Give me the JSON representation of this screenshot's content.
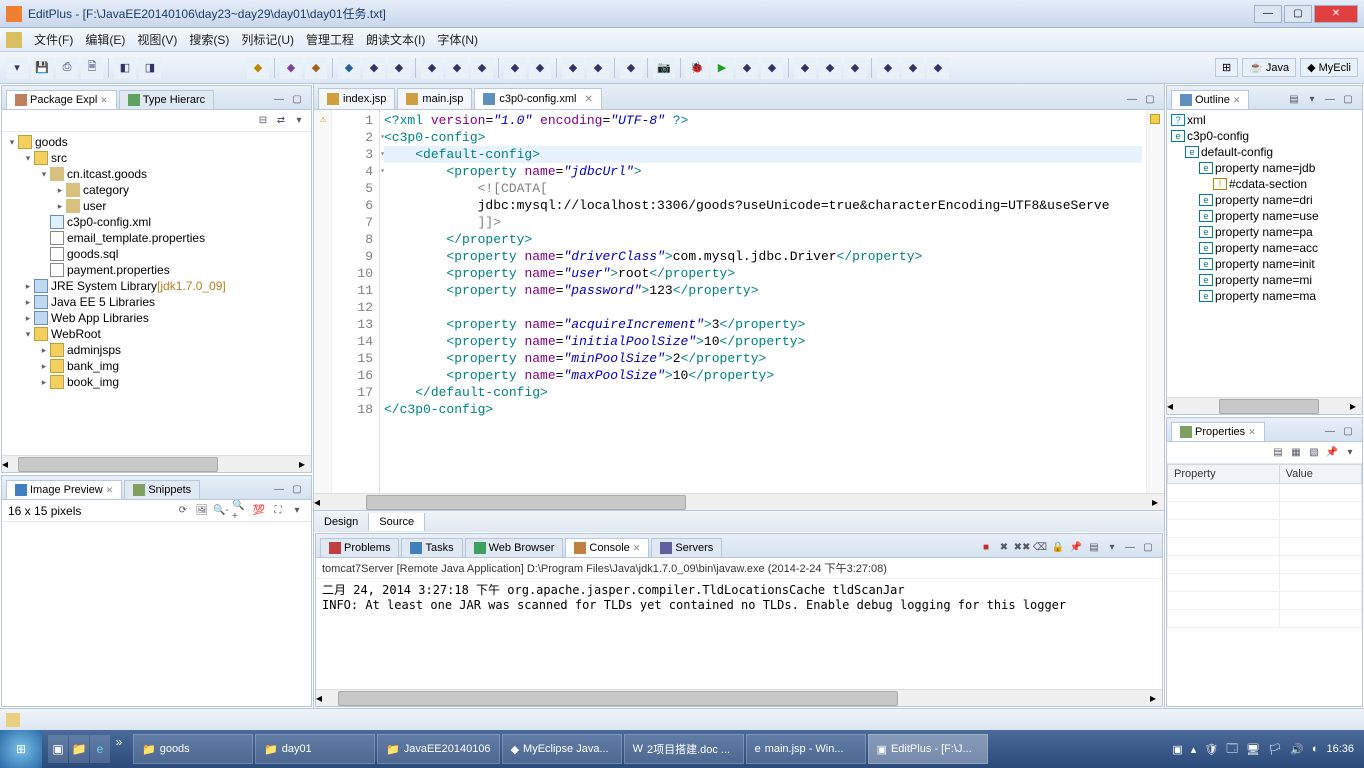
{
  "title": "EditPlus - [F:\\JavaEE20140106\\day23~day29\\day01\\day01任务.txt]",
  "menu": [
    "文件(F)",
    "编辑(E)",
    "视图(V)",
    "搜索(S)",
    "列标记(U)",
    "管理工程",
    "朗读文本(I)",
    "字体(N)"
  ],
  "perspectives": [
    {
      "label": "Java"
    },
    {
      "label": "MyEcli"
    }
  ],
  "package_explorer": {
    "tab": "Package Expl",
    "tab2": "Type Hierarc",
    "tree": [
      {
        "level": 0,
        "icon": "ic-folder",
        "label": "goods",
        "tw": "▾"
      },
      {
        "level": 1,
        "icon": "ic-folder",
        "label": "src",
        "tw": "▾"
      },
      {
        "level": 2,
        "icon": "ic-pkg",
        "label": "cn.itcast.goods",
        "tw": "▾"
      },
      {
        "level": 3,
        "icon": "ic-pkg",
        "label": "category",
        "tw": "▸"
      },
      {
        "level": 3,
        "icon": "ic-pkg",
        "label": "user",
        "tw": "▸"
      },
      {
        "level": 2,
        "icon": "ic-xml",
        "label": "c3p0-config.xml",
        "tw": ""
      },
      {
        "level": 2,
        "icon": "ic-file",
        "label": "email_template.properties",
        "tw": ""
      },
      {
        "level": 2,
        "icon": "ic-file",
        "label": "goods.sql",
        "tw": ""
      },
      {
        "level": 2,
        "icon": "ic-file",
        "label": "payment.properties",
        "tw": ""
      },
      {
        "level": 1,
        "icon": "ic-lib",
        "label": "JRE System Library",
        "suffix": "[jdk1.7.0_09]",
        "tw": "▸"
      },
      {
        "level": 1,
        "icon": "ic-lib",
        "label": "Java EE 5 Libraries",
        "tw": "▸"
      },
      {
        "level": 1,
        "icon": "ic-lib",
        "label": "Web App Libraries",
        "tw": "▸"
      },
      {
        "level": 1,
        "icon": "ic-folder",
        "label": "WebRoot",
        "tw": "▾"
      },
      {
        "level": 2,
        "icon": "ic-folder",
        "label": "adminjsps",
        "tw": "▸"
      },
      {
        "level": 2,
        "icon": "ic-folder",
        "label": "bank_img",
        "tw": "▸"
      },
      {
        "level": 2,
        "icon": "ic-folder",
        "label": "book_img",
        "tw": "▸"
      }
    ]
  },
  "image_preview": {
    "tab": "Image Preview",
    "tab2": "Snippets",
    "status": "16 x 15 pixels"
  },
  "editor_tabs": [
    {
      "label": "index.jsp",
      "active": false
    },
    {
      "label": "main.jsp",
      "active": false
    },
    {
      "label": "c3p0-config.xml",
      "active": true
    }
  ],
  "code": {
    "lines": [
      {
        "n": 1,
        "warn": true,
        "html": "<span class='t-pi'>&lt;?xml</span> <span class='t-attr'>version</span>=<span class='t-str'>\"1.0\"</span> <span class='t-attr'>encoding</span>=<span class='t-str'>\"UTF-8\"</span> <span class='t-pi'>?&gt;</span>"
      },
      {
        "n": 2,
        "fold": true,
        "html": "<span class='t-tag'>&lt;c3p0-config&gt;</span>"
      },
      {
        "n": 3,
        "fold": true,
        "hl": true,
        "html": "    <span class='t-tag'>&lt;default-config&gt;</span>"
      },
      {
        "n": 4,
        "fold": true,
        "html": "        <span class='t-tag'>&lt;property</span> <span class='t-attr'>name</span>=<span class='t-str'>\"jdbcUrl\"</span><span class='t-tag'>&gt;</span>"
      },
      {
        "n": 5,
        "html": "            <span class='t-cd'>&lt;![CDATA[</span>"
      },
      {
        "n": 6,
        "html": "            <span class='t-txt'>jdbc:mysql://localhost:3306/goods?useUnicode=true&amp;characterEncoding=UTF8&amp;useServe</span>"
      },
      {
        "n": 7,
        "html": "            <span class='t-cd'>]]&gt;</span>"
      },
      {
        "n": 8,
        "html": "        <span class='t-tag'>&lt;/property&gt;</span>"
      },
      {
        "n": 9,
        "html": "        <span class='t-tag'>&lt;property</span> <span class='t-attr'>name</span>=<span class='t-str'>\"driverClass\"</span><span class='t-tag'>&gt;</span><span class='t-txt'>com.mysql.jdbc.Driver</span><span class='t-tag'>&lt;/property&gt;</span>"
      },
      {
        "n": 10,
        "html": "        <span class='t-tag'>&lt;property</span> <span class='t-attr'>name</span>=<span class='t-str'>\"user\"</span><span class='t-tag'>&gt;</span><span class='t-txt'>root</span><span class='t-tag'>&lt;/property&gt;</span>"
      },
      {
        "n": 11,
        "html": "        <span class='t-tag'>&lt;property</span> <span class='t-attr'>name</span>=<span class='t-str'>\"password\"</span><span class='t-tag'>&gt;</span><span class='t-txt'>123</span><span class='t-tag'>&lt;/property&gt;</span>"
      },
      {
        "n": 12,
        "html": ""
      },
      {
        "n": 13,
        "html": "        <span class='t-tag'>&lt;property</span> <span class='t-attr'>name</span>=<span class='t-str'>\"acquireIncrement\"</span><span class='t-tag'>&gt;</span><span class='t-txt'>3</span><span class='t-tag'>&lt;/property&gt;</span>"
      },
      {
        "n": 14,
        "html": "        <span class='t-tag'>&lt;property</span> <span class='t-attr'>name</span>=<span class='t-str'>\"initialPoolSize\"</span><span class='t-tag'>&gt;</span><span class='t-txt'>10</span><span class='t-tag'>&lt;/property&gt;</span>"
      },
      {
        "n": 15,
        "html": "        <span class='t-tag'>&lt;property</span> <span class='t-attr'>name</span>=<span class='t-str'>\"minPoolSize\"</span><span class='t-tag'>&gt;</span><span class='t-txt'>2</span><span class='t-tag'>&lt;/property&gt;</span>"
      },
      {
        "n": 16,
        "html": "        <span class='t-tag'>&lt;property</span> <span class='t-attr'>name</span>=<span class='t-str'>\"maxPoolSize\"</span><span class='t-tag'>&gt;</span><span class='t-txt'>10</span><span class='t-tag'>&lt;/property&gt;</span>"
      },
      {
        "n": 17,
        "html": "    <span class='t-tag'>&lt;/default-config&gt;</span>"
      },
      {
        "n": 18,
        "html": "<span class='t-tag'>&lt;/c3p0-config&gt;</span>"
      }
    ]
  },
  "editor_bottom": [
    "Design",
    "Source"
  ],
  "console": {
    "tabs": [
      "Problems",
      "Tasks",
      "Web Browser",
      "Console",
      "Servers"
    ],
    "head": "tomcat7Server [Remote Java Application] D:\\Program Files\\Java\\jdk1.7.0_09\\bin\\javaw.exe (2014-2-24 下午3:27:08)",
    "lines": [
      "二月 24, 2014 3:27:18 下午 org.apache.jasper.compiler.TldLocationsCache tldScanJar",
      "INFO: At least one JAR was scanned for TLDs yet contained no TLDs. Enable debug logging for this logger"
    ]
  },
  "outline": {
    "tab": "Outline",
    "items": [
      {
        "level": 0,
        "icon": "?",
        "label": "xml"
      },
      {
        "level": 0,
        "icon": "e",
        "label": "c3p0-config"
      },
      {
        "level": 1,
        "icon": "e",
        "label": "default-config"
      },
      {
        "level": 2,
        "icon": "e",
        "label": "property name=jdb"
      },
      {
        "level": 3,
        "icon": "!",
        "label": "#cdata-section"
      },
      {
        "level": 2,
        "icon": "e",
        "label": "property name=dri"
      },
      {
        "level": 2,
        "icon": "e",
        "label": "property name=use"
      },
      {
        "level": 2,
        "icon": "e",
        "label": "property name=pa"
      },
      {
        "level": 2,
        "icon": "e",
        "label": "property name=acc"
      },
      {
        "level": 2,
        "icon": "e",
        "label": "property name=init"
      },
      {
        "level": 2,
        "icon": "e",
        "label": "property name=mi"
      },
      {
        "level": 2,
        "icon": "e",
        "label": "property name=ma"
      }
    ]
  },
  "properties": {
    "tab": "Properties",
    "cols": [
      "Property",
      "Value"
    ]
  },
  "taskbar": {
    "items": [
      {
        "label": "goods",
        "icon": "📁"
      },
      {
        "label": "day01",
        "icon": "📁"
      },
      {
        "label": "JavaEE20140106",
        "icon": "📁"
      },
      {
        "label": "MyEclipse Java...",
        "icon": "◆"
      },
      {
        "label": "2项目搭建.doc ...",
        "icon": "W"
      },
      {
        "label": "main.jsp - Win...",
        "icon": "e"
      },
      {
        "label": "EditPlus - [F:\\J...",
        "icon": "▣",
        "active": true
      }
    ],
    "time": "16:36"
  }
}
